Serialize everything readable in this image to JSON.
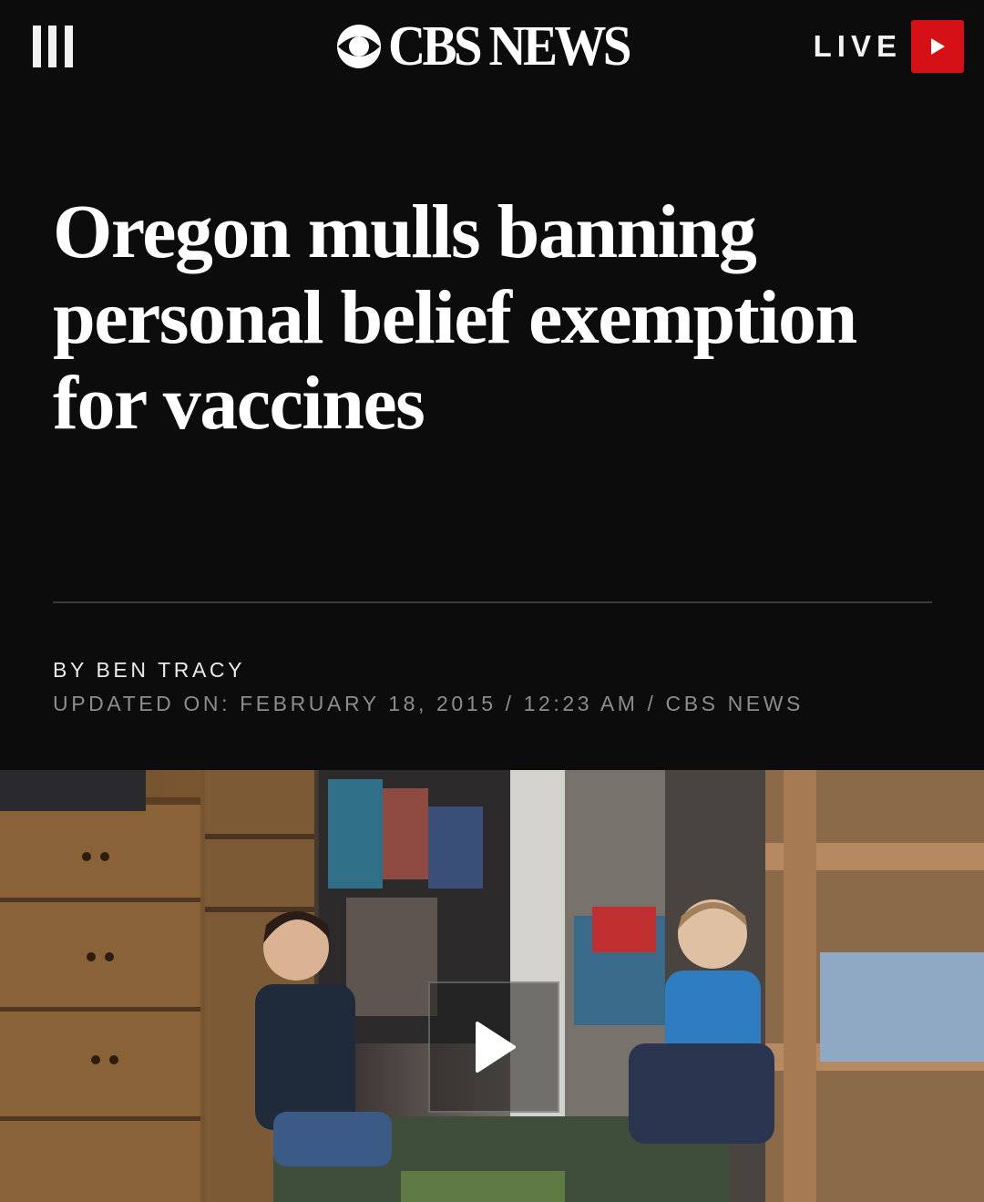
{
  "header": {
    "menu_icon": "hamburger-menu-icon",
    "logo_text": "CBS NEWS",
    "logo_icon": "cbs-eye-icon",
    "live_label": "LIVE",
    "live_icon": "play-triangle-icon"
  },
  "article": {
    "headline": "Oregon mulls banning personal belief exemption for vaccines",
    "byline": "BY BEN TRACY",
    "dateline": "UPDATED ON: FEBRUARY 18, 2015 / 12:23 AM / CBS NEWS"
  },
  "video": {
    "play_icon": "play-icon"
  },
  "colors": {
    "background": "#0c0c0c",
    "accent_red": "#d40f16",
    "text": "#ffffff",
    "muted_text": "#8d8d8d"
  }
}
